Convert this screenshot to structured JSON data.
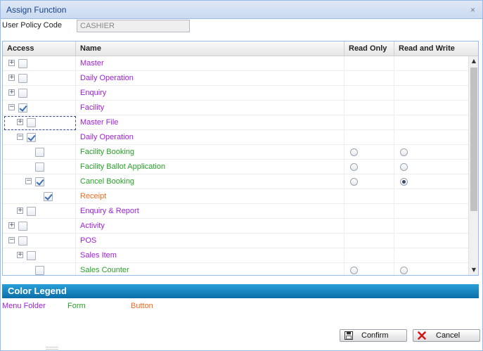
{
  "window": {
    "title": "Assign Function",
    "close_symbol": "×"
  },
  "policy": {
    "label": "User Policy Code",
    "value": "CASHIER"
  },
  "columns": {
    "access": "Access",
    "name": "Name",
    "read_only": "Read Only",
    "read_write": "Read and Write"
  },
  "rows": [
    {
      "name": "Master",
      "kind": "folder",
      "level": 0,
      "expander": "+",
      "checked": false
    },
    {
      "name": "Daily Operation",
      "kind": "folder",
      "level": 0,
      "expander": "+",
      "checked": false
    },
    {
      "name": "Enquiry",
      "kind": "folder",
      "level": 0,
      "expander": "+",
      "checked": false
    },
    {
      "name": "Facility",
      "kind": "folder",
      "level": 0,
      "expander": "−",
      "checked": true
    },
    {
      "name": "Master File",
      "kind": "folder",
      "level": 1,
      "expander": "+",
      "checked": false,
      "focused": true
    },
    {
      "name": "Daily Operation",
      "kind": "folder",
      "level": 1,
      "expander": "−",
      "checked": true
    },
    {
      "name": "Facility Booking",
      "kind": "form",
      "level": 2,
      "checked": false,
      "ro": false,
      "rw": false
    },
    {
      "name": "Facility Ballot Application",
      "kind": "form",
      "level": 2,
      "checked": false,
      "ro": false,
      "rw": false
    },
    {
      "name": "Cancel Booking",
      "kind": "form",
      "level": 2,
      "expander": "−",
      "checked": true,
      "ro": false,
      "rw": true
    },
    {
      "name": "Receipt",
      "kind": "button",
      "level": 3,
      "checked": true
    },
    {
      "name": "Enquiry & Report",
      "kind": "folder",
      "level": 1,
      "expander": "+",
      "checked": false
    },
    {
      "name": "Activity",
      "kind": "folder",
      "level": 0,
      "expander": "+",
      "checked": false
    },
    {
      "name": "POS",
      "kind": "folder",
      "level": 0,
      "expander": "−",
      "checked": false
    },
    {
      "name": "Sales Item",
      "kind": "folder",
      "level": 1,
      "expander": "+",
      "checked": false
    },
    {
      "name": "Sales Counter",
      "kind": "form",
      "level": 2,
      "checked": false,
      "ro": false,
      "rw": false
    }
  ],
  "legend": {
    "title": "Color Legend",
    "items": [
      {
        "label": "Menu Folder",
        "color": "#a020d8"
      },
      {
        "label": "Form",
        "color": "#28a028"
      },
      {
        "label": "Button",
        "color": "#f06a1e"
      }
    ]
  },
  "buttons": {
    "confirm": "Confirm",
    "cancel": "Cancel"
  },
  "scrollbar": {
    "up_glyph": "▲",
    "down_glyph": "▼"
  },
  "icons": {
    "confirm": "save-disk-icon",
    "cancel": "red-x-icon"
  }
}
